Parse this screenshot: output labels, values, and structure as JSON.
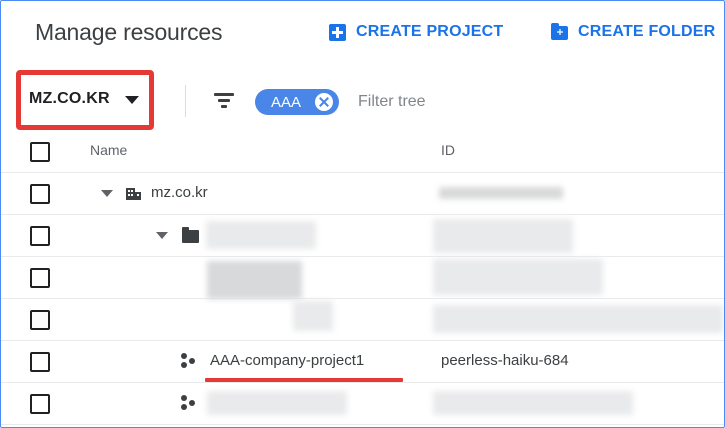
{
  "header": {
    "title": "Manage resources",
    "create_project_label": "CREATE PROJECT",
    "create_folder_label": "CREATE FOLDER"
  },
  "toolbar": {
    "org_selector": "MZ.CO.KR",
    "filter_chip": "AAA",
    "filter_placeholder": "Filter tree"
  },
  "table": {
    "columns": [
      "Name",
      "ID"
    ],
    "rows": [
      {
        "name": "mz.co.kr",
        "id": "",
        "type": "organization",
        "note": "id blurred"
      },
      {
        "name": "",
        "id": "",
        "type": "folder",
        "note": "name and id blurred"
      },
      {
        "name": "",
        "id": "",
        "type": "blurred"
      },
      {
        "name": "",
        "id": "",
        "type": "blurred"
      },
      {
        "name": "AAA-company-project1",
        "id": "peerless-haiku-684",
        "type": "project"
      },
      {
        "name": "",
        "id": "",
        "type": "project",
        "note": "name and id blurred"
      }
    ]
  },
  "colors": {
    "accent": "#1a73e8",
    "highlight": "#e53935",
    "chip": "#4a86e8"
  },
  "icons": [
    "add-box-icon",
    "create-folder-icon",
    "dropdown-caret-icon",
    "filter-icon",
    "chip-close-icon",
    "organization-icon",
    "folder-icon",
    "project-icon",
    "expand-arrow-icon",
    "checkbox-icon"
  ]
}
